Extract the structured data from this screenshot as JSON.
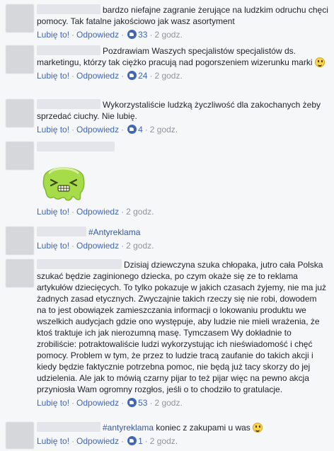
{
  "actions": {
    "like_label": "Lubię to!",
    "reply_label": "Odpowiedz",
    "separator": "·"
  },
  "colors": {
    "link": "#4267b2",
    "meta": "#90949c",
    "text": "#1d2129",
    "background": "#f6f7f9"
  },
  "comments": [
    {
      "text": "bardzo niefajne zagranie żerujące na ludzkim odruchu chęci pomocy. Tak fatalne jakościowo jak wasz asortyment",
      "likes": "33",
      "time": "2 godz."
    },
    {
      "text": "Pozdrawiam Waszych specjalistów specjalistów ds. marketingu, którzy tak ciężko pracują nad pogorszeniem wizerunku marki",
      "emoji": "laughing-emoji",
      "likes": "24",
      "time": "2 godz."
    },
    {
      "text": "Wykorzystaliście ludzką życzliwość dla zakochanych żeby sprzedać ciuchy. Nie lubię.",
      "likes": "4",
      "time": "2 godz."
    },
    {
      "sticker": "sick-green-blob-sticker",
      "time": "2 godz."
    },
    {
      "hashtag": "#Antyreklama",
      "time": "2 godz."
    },
    {
      "text": "Dzisiaj dziewczyna szuka chłopaka, jutro cała Polska szukać będzie zaginionego dziecka, po czym okaże się ze to reklama artykułów dziecięcych. To tylko pokazuje w jakich czasach żyjemy, nie ma już żadnych zasad etycznych. Zwyczajnie takich rzeczy się nie robi, dowodem na to jest obowiązek zamieszczania informacji o lokowaniu produktu we wszelkich audycjach gdzie ono występuje, aby ludzie nie mieli wrażenia, że ktoś traktuje ich jak nierozumną masę. Tymczasem Wy dokładnie to zrobiliście: potraktowaliście ludzi wykorzystując ich nieświadomość i chęć pomocy. Problem w tym, że przez to ludzie tracą zaufanie do takich akcji i kiedy będzie faktycznie potrzebna pomoc, nie będą już tacy skorzy do jej udzielenia. Ale jak to mówią czarny pijar to też pijar więc na pewno akcja przyniosła Wam ogromny rozgłos, jeśli o to chodziło to gratulacje.",
      "likes": "53",
      "time": "2 godz."
    },
    {
      "hashtag": "#antyreklama",
      "text": "koniec z zakupami u was",
      "emoji": "smiling-emoji",
      "likes": "1",
      "time": "2 godz."
    }
  ]
}
